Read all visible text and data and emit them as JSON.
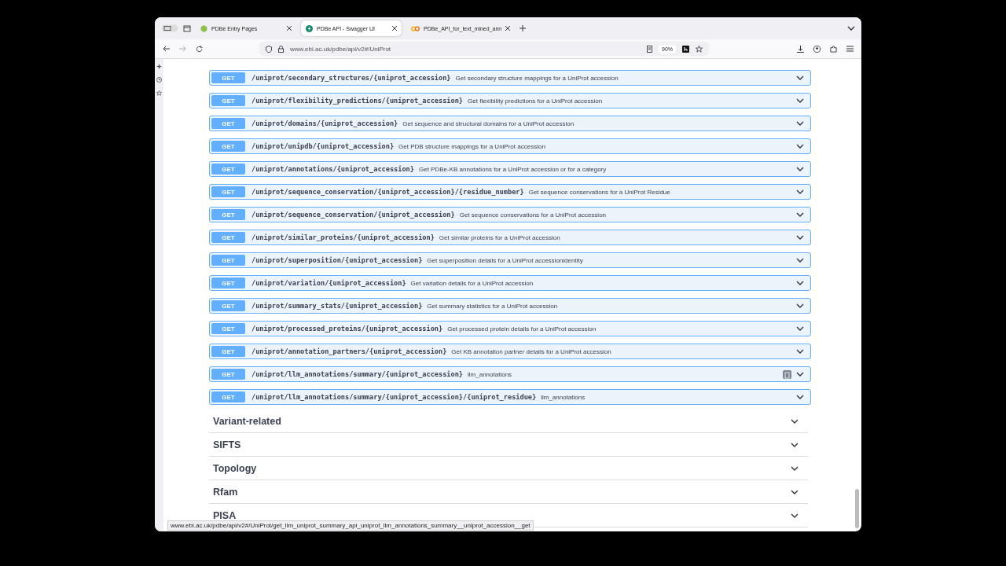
{
  "tabs": [
    {
      "label": "PDBe Entry Pages",
      "selected": false
    },
    {
      "label": "PDBe API - Swagger UI",
      "selected": true
    },
    {
      "label": "PDBe_API_for_text_mined_ann",
      "selected": false
    }
  ],
  "address_bar": {
    "url": "www.ebi.ac.uk/pdbe/api/v2#/UniProt",
    "zoom": "90%"
  },
  "endpoints": [
    {
      "method": "GET",
      "path": "/uniprot/secondary_structures/{uniprot_accession}",
      "description": "Get secondary structure mappings for a UniProt accession",
      "hovered": false
    },
    {
      "method": "GET",
      "path": "/uniprot/flexibility_predictions/{uniprot_accession}",
      "description": "Get flexibility predictions for a UniProt accession",
      "hovered": false
    },
    {
      "method": "GET",
      "path": "/uniprot/domains/{uniprot_accession}",
      "description": "Get sequence and structural domains for a UniProt accession",
      "hovered": false
    },
    {
      "method": "GET",
      "path": "/uniprot/unipdb/{uniprot_accession}",
      "description": "Get PDB structure mappings for a UniProt accession",
      "hovered": false
    },
    {
      "method": "GET",
      "path": "/uniprot/annotations/{uniprot_accession}",
      "description": "Get PDBe-KB annotations for a UniProt accession or for a category",
      "hovered": false
    },
    {
      "method": "GET",
      "path": "/uniprot/sequence_conservation/{uniprot_accession}/{residue_number}",
      "description": "Get sequence conservations for a UniProt Residue",
      "hovered": false
    },
    {
      "method": "GET",
      "path": "/uniprot/sequence_conservation/{uniprot_accession}",
      "description": "Get sequence conservations for a UniProt accession",
      "hovered": false
    },
    {
      "method": "GET",
      "path": "/uniprot/similar_proteins/{uniprot_accession}",
      "description": "Get similar proteins for a UniProt accession",
      "hovered": false
    },
    {
      "method": "GET",
      "path": "/uniprot/superposition/{uniprot_accession}",
      "description": "Get superposition details for a UniProt accessionidentity",
      "hovered": false
    },
    {
      "method": "GET",
      "path": "/uniprot/variation/{uniprot_accession}",
      "description": "Get variation details for a UniProt accession",
      "hovered": false
    },
    {
      "method": "GET",
      "path": "/uniprot/summary_stats/{uniprot_accession}",
      "description": "Get summary statistics for a UniProt accession",
      "hovered": false
    },
    {
      "method": "GET",
      "path": "/uniprot/processed_proteins/{uniprot_accession}",
      "description": "Get processed protein details for a UniProt accession",
      "hovered": false
    },
    {
      "method": "GET",
      "path": "/uniprot/annotation_partners/{uniprot_accession}",
      "description": "Get KB annotation partner details for a UniProt accession",
      "hovered": false
    },
    {
      "method": "GET",
      "path": "/uniprot/llm_annotations/summary/{uniprot_accession}",
      "description": "llm_annotations",
      "hovered": true
    },
    {
      "method": "GET",
      "path": "/uniprot/llm_annotations/summary/{uniprot_accession}/{uniprot_residue}",
      "description": "llm_annotations",
      "hovered": false
    }
  ],
  "sections": [
    {
      "title": "Variant-related",
      "expanded": false
    },
    {
      "title": "SIFTS",
      "expanded": false
    },
    {
      "title": "Topology",
      "expanded": false
    },
    {
      "title": "Rfam",
      "expanded": false
    },
    {
      "title": "PISA",
      "expanded": false
    }
  ],
  "status_bar": {
    "link": "www.ebi.ac.uk/pdbe/api/v2#/UniProt/get_llm_uniprot_summary_api_uniprot_llm_annotations_summary__uniprot_accession__get"
  }
}
